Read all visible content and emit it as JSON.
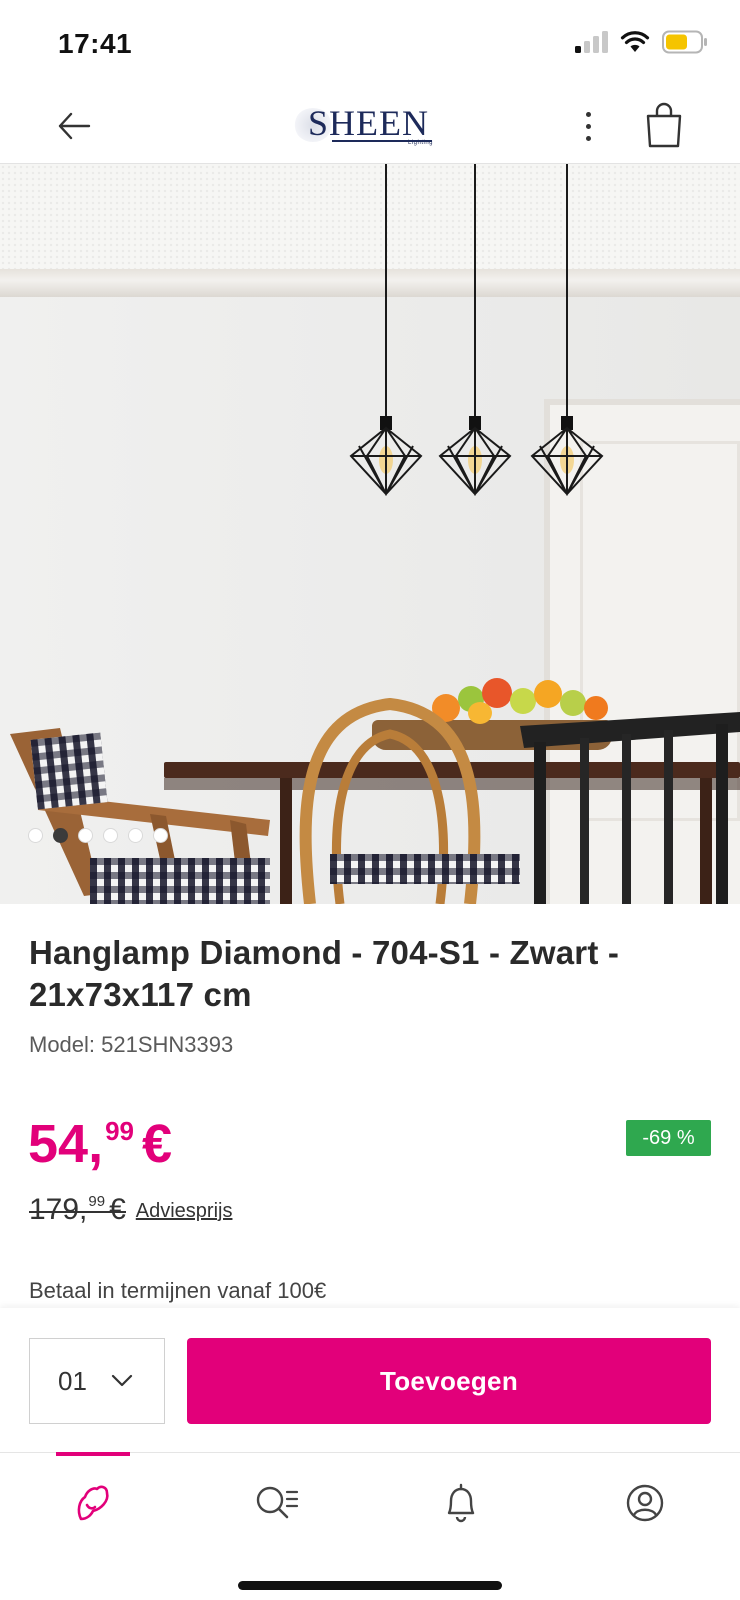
{
  "status_bar": {
    "time": "17:41"
  },
  "header": {
    "logo_text": "SHEEN",
    "logo_subtext": "Lighting"
  },
  "product": {
    "title": "Hanglamp Diamond - 704-S1 - Zwart - 21x73x117 cm",
    "model": "Model: 521SHN3393",
    "image_count": 6,
    "active_image_index": 1
  },
  "price": {
    "current_int": "54,",
    "current_dec": "99",
    "currency": "€",
    "old_int": "179,",
    "old_dec": "99",
    "old_currency": "€",
    "advice_label": "Adviesprijs",
    "discount": "-69 %",
    "installments": "Betaal in termijnen vanaf 100€"
  },
  "cart": {
    "quantity": "01",
    "add_label": "Toevoegen"
  },
  "nav": {
    "items": [
      "home-icon",
      "search-list-icon",
      "bell-icon",
      "account-icon"
    ],
    "active": "home-icon"
  },
  "colors": {
    "accent": "#e2007a",
    "discount": "#2fa84f",
    "logo": "#1d2a5a"
  }
}
